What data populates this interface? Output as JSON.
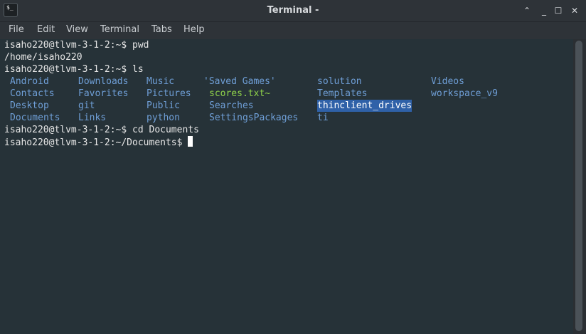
{
  "window": {
    "title": "Terminal -",
    "icon": "terminal-icon"
  },
  "controls": {
    "minimize": "⌃",
    "restore": "_",
    "maximize": "☐",
    "close": "✕"
  },
  "menubar": {
    "items": [
      "File",
      "Edit",
      "View",
      "Terminal",
      "Tabs",
      "Help"
    ]
  },
  "terminal": {
    "prompt_home": "isaho220@tlvm-3-1-2:~$",
    "prompt_docs": "isaho220@tlvm-3-1-2:~/Documents$",
    "cmd_pwd": " pwd",
    "out_pwd": "/home/isaho220",
    "cmd_ls": " ls",
    "cmd_cd": " cd Documents",
    "ls": {
      "col1": [
        "Android",
        "Contacts",
        "Desktop",
        "Documents"
      ],
      "col2": [
        "Downloads",
        "Favorites",
        "git",
        "Links"
      ],
      "col3": [
        "Music",
        "Pictures",
        "Public",
        "python"
      ],
      "col4": [
        "'Saved Games'",
        "scores.txt~",
        "Searches",
        "SettingsPackages"
      ],
      "col5": [
        "solution",
        "Templates",
        "thinclient_drives",
        "ti"
      ],
      "col6": [
        "Videos",
        "workspace_v9"
      ]
    }
  },
  "colors": {
    "background": "#263238",
    "directory": "#6f9fd7",
    "executable": "#8fd24a",
    "selection": "#2f61a8"
  }
}
